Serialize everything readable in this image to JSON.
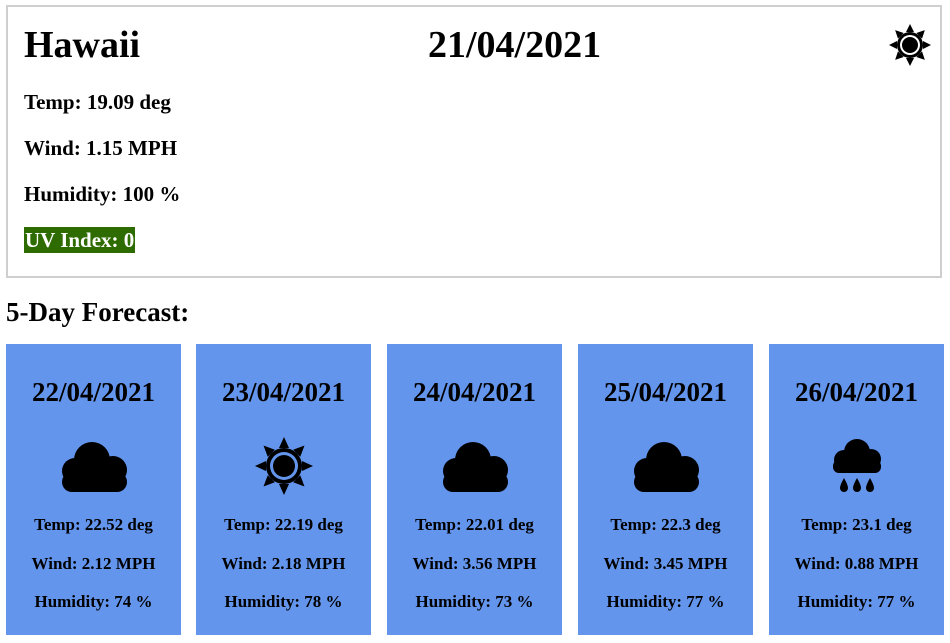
{
  "current": {
    "city": "Hawaii",
    "date": "21/04/2021",
    "icon": "sun-icon",
    "temp": "Temp: 19.09 deg",
    "wind": "Wind: 1.15 MPH",
    "humidity": "Humidity: 100 %",
    "uv": "UV Index: 0",
    "uv_color": "#2e6b00"
  },
  "forecast": {
    "title": "5-Day Forecast:",
    "card_color": "#6495ed",
    "days": [
      {
        "date": "22/04/2021",
        "icon": "cloud-icon",
        "temp": "Temp: 22.52 deg",
        "wind": "Wind: 2.12 MPH",
        "humidity": "Humidity: 74 %"
      },
      {
        "date": "23/04/2021",
        "icon": "sun-icon",
        "temp": "Temp: 22.19 deg",
        "wind": "Wind: 2.18 MPH",
        "humidity": "Humidity: 78 %"
      },
      {
        "date": "24/04/2021",
        "icon": "cloud-icon",
        "temp": "Temp: 22.01 deg",
        "wind": "Wind: 3.56 MPH",
        "humidity": "Humidity: 73 %"
      },
      {
        "date": "25/04/2021",
        "icon": "cloud-icon",
        "temp": "Temp: 22.3 deg",
        "wind": "Wind: 3.45 MPH",
        "humidity": "Humidity: 77 %"
      },
      {
        "date": "26/04/2021",
        "icon": "rain-icon",
        "temp": "Temp: 23.1 deg",
        "wind": "Wind: 0.88 MPH",
        "humidity": "Humidity: 77 %"
      }
    ]
  }
}
